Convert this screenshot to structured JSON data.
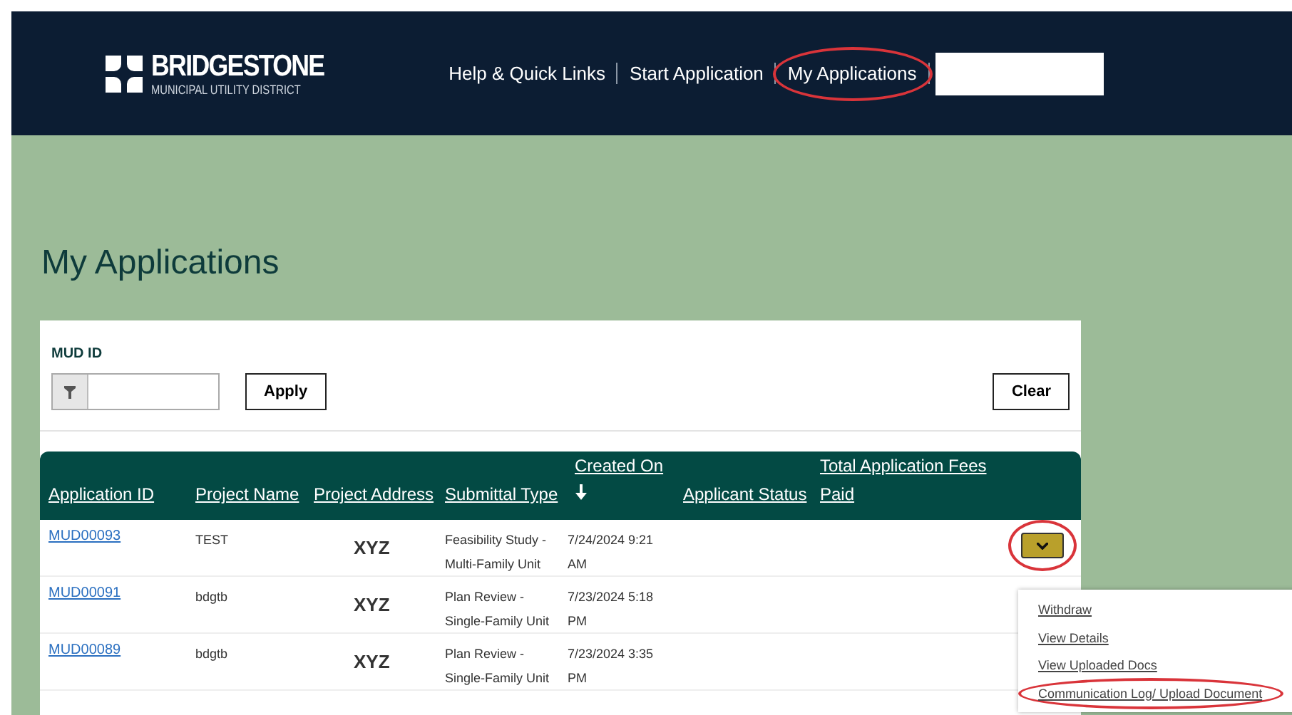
{
  "header": {
    "logo": {
      "name": "BRIDGESTONE",
      "subtitle": "MUNICIPAL UTILITY DISTRICT"
    },
    "nav": [
      {
        "label": "Help & Quick Links",
        "highlighted": false
      },
      {
        "label": "Start Application",
        "highlighted": false
      },
      {
        "label": "My Applications",
        "highlighted": true
      }
    ]
  },
  "page_title": "My Applications",
  "filter": {
    "label": "MUD ID",
    "apply": "Apply",
    "clear": "Clear"
  },
  "table": {
    "columns": [
      {
        "label": "Application ID"
      },
      {
        "label": "Project Name"
      },
      {
        "label": "Project Address"
      },
      {
        "label": "Submittal Type"
      },
      {
        "label": "Created On",
        "sorted": true
      },
      {
        "label": "Applicant Status"
      },
      {
        "label": "Total Application Fees Paid"
      }
    ],
    "rows": [
      {
        "id": "MUD00093",
        "name": "TEST",
        "address": "XYZ",
        "type": "Feasibility Study - Multi-Family Unit",
        "created": "7/24/2024 9:21 AM",
        "actions": {
          "menu_open": true,
          "highlighted": true
        }
      },
      {
        "id": "MUD00091",
        "name": "bdgtb",
        "address": "XYZ",
        "type": "Plan Review - Single-Family Unit",
        "created": "7/23/2024 5:18 PM"
      },
      {
        "id": "MUD00089",
        "name": "bdgtb",
        "address": "XYZ",
        "type": "Plan Review - Single-Family Unit",
        "created": "7/23/2024 3:35 PM"
      }
    ]
  },
  "action_menu": [
    {
      "label": "Withdraw",
      "highlighted": false
    },
    {
      "label": "View Details",
      "highlighted": false
    },
    {
      "label": "View Uploaded Docs",
      "highlighted": false
    },
    {
      "label": "Communication Log/ Upload Document",
      "highlighted": true
    }
  ]
}
